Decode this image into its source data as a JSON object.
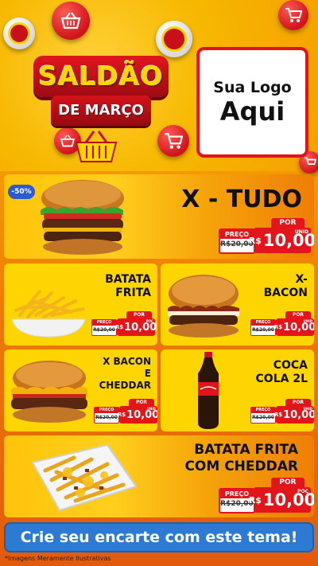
{
  "header": {
    "title_line1": "SALDÃO",
    "title_line2": "DE MARÇO",
    "logo_line1": "Sua Logo",
    "logo_line2": "Aqui"
  },
  "featured": {
    "discount_badge": "-50%",
    "name": "X - TUDO",
    "por_label": "POR",
    "preco_label": "PREÇO",
    "old_price": "R$20,00",
    "currency": "R$",
    "price": "10,00",
    "unit": "UNID"
  },
  "items": [
    {
      "name_line1": "BATATA",
      "name_line2": "FRITA",
      "por_label": "POR",
      "preco_label": "PREÇO",
      "old_price": "R$20,00",
      "currency": "R$",
      "price": "10,00",
      "unit": "POÇ"
    },
    {
      "name_line1": "X-",
      "name_line2": "BACON",
      "por_label": "POR",
      "preco_label": "PREÇO",
      "old_price": "R$20,00",
      "currency": "R$",
      "price": "10,00",
      "unit": "UNID"
    },
    {
      "name_line1": "X BACON",
      "name_line2": "E",
      "name_line3": "CHEDDAR",
      "por_label": "POR",
      "preco_label": "PREÇO",
      "old_price": "R$20,00",
      "currency": "R$",
      "price": "10,00",
      "unit": "UNID"
    },
    {
      "name_line1": "COCA",
      "name_line2": "COLA 2L",
      "por_label": "POR",
      "preco_label": "PREÇO",
      "old_price": "R$20,00",
      "currency": "R$",
      "price": "10,00",
      "unit": "UNID"
    }
  ],
  "bottom_item": {
    "name_line1": "BATATA FRITA",
    "name_line2": "COM CHEDDAR",
    "por_label": "POR",
    "preco_label": "PREÇO",
    "old_price": "R$20,00",
    "currency": "R$",
    "price": "10,00",
    "unit": "POÇ"
  },
  "cta": "Crie seu encarte com este tema!",
  "disclaimer": "*Imagens Meramente Ilustrativas",
  "colors": {
    "brand_red": "#e4141b",
    "brand_yellow": "#ffd500",
    "cta_blue": "#2c7ad3"
  }
}
